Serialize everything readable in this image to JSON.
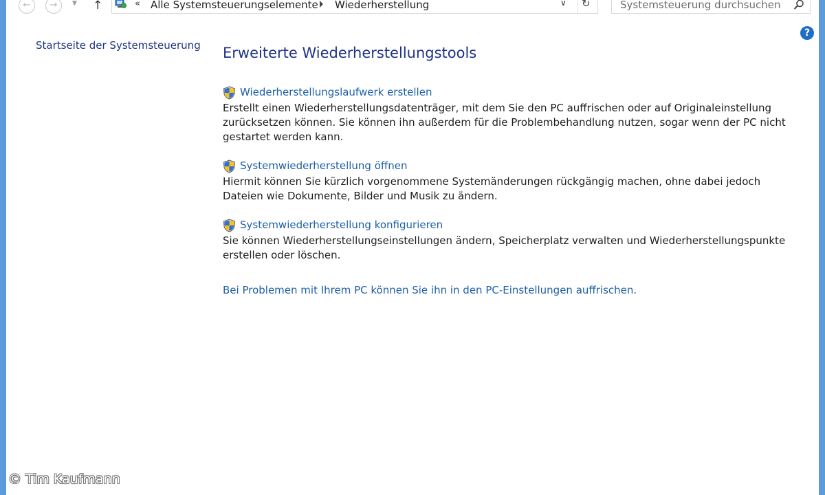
{
  "nav": {
    "back_glyph": "←",
    "forward_glyph": "→",
    "history_glyph": "▼",
    "up_glyph": "↑"
  },
  "address_bar": {
    "overflow": "«",
    "crumbs": [
      "Alle Systemsteuerungselemente",
      "Wiederherstellung"
    ],
    "dropdown_glyph": "∨",
    "refresh_glyph": "↻"
  },
  "search": {
    "placeholder": "Systemsteuerung durchsuchen"
  },
  "help": {
    "label": "?"
  },
  "left_pane": {
    "link": "Startseite der Systemsteuerung"
  },
  "main": {
    "title": "Erweiterte Wiederherstellungstools",
    "tasks": [
      {
        "link": "Wiederherstellungslaufwerk erstellen",
        "description_lines": [
          "Erstellt einen Wiederherstellungsdatenträger, mit dem Sie den PC auffrischen oder auf Originaleinstellung",
          "zurücksetzen können. Sie können ihn außerdem für die Problembehandlung nutzen, sogar wenn der PC nicht",
          "gestartet werden kann."
        ]
      },
      {
        "link": "Systemwiederherstellung öffnen",
        "description_lines": [
          "Hiermit können Sie kürzlich vorgenommene Systemänderungen rückgängig machen, ohne dabei jedoch",
          "Dateien wie Dokumente, Bilder und Musik zu ändern."
        ]
      },
      {
        "link": "Systemwiederherstellung konfigurieren",
        "description_lines": [
          "Sie können Wiederherstellungseinstellungen ändern, Speicherplatz verwalten und Wiederherstellungspunkte",
          "erstellen oder löschen."
        ]
      }
    ],
    "bottom_link": "Bei Problemen mit Ihrem PC können Sie ihn in den PC-Einstellungen auffrischen."
  },
  "watermark": "© Tim Kaufmann",
  "colors": {
    "frame": "#5d9cdc",
    "heading": "#1e3287",
    "link": "#1e5fa8",
    "text": "#1e1e1e",
    "help": "#1f6fc5"
  },
  "icons": [
    "shield-icon",
    "search-icon",
    "help-icon",
    "control-panel-icon",
    "refresh-icon"
  ]
}
